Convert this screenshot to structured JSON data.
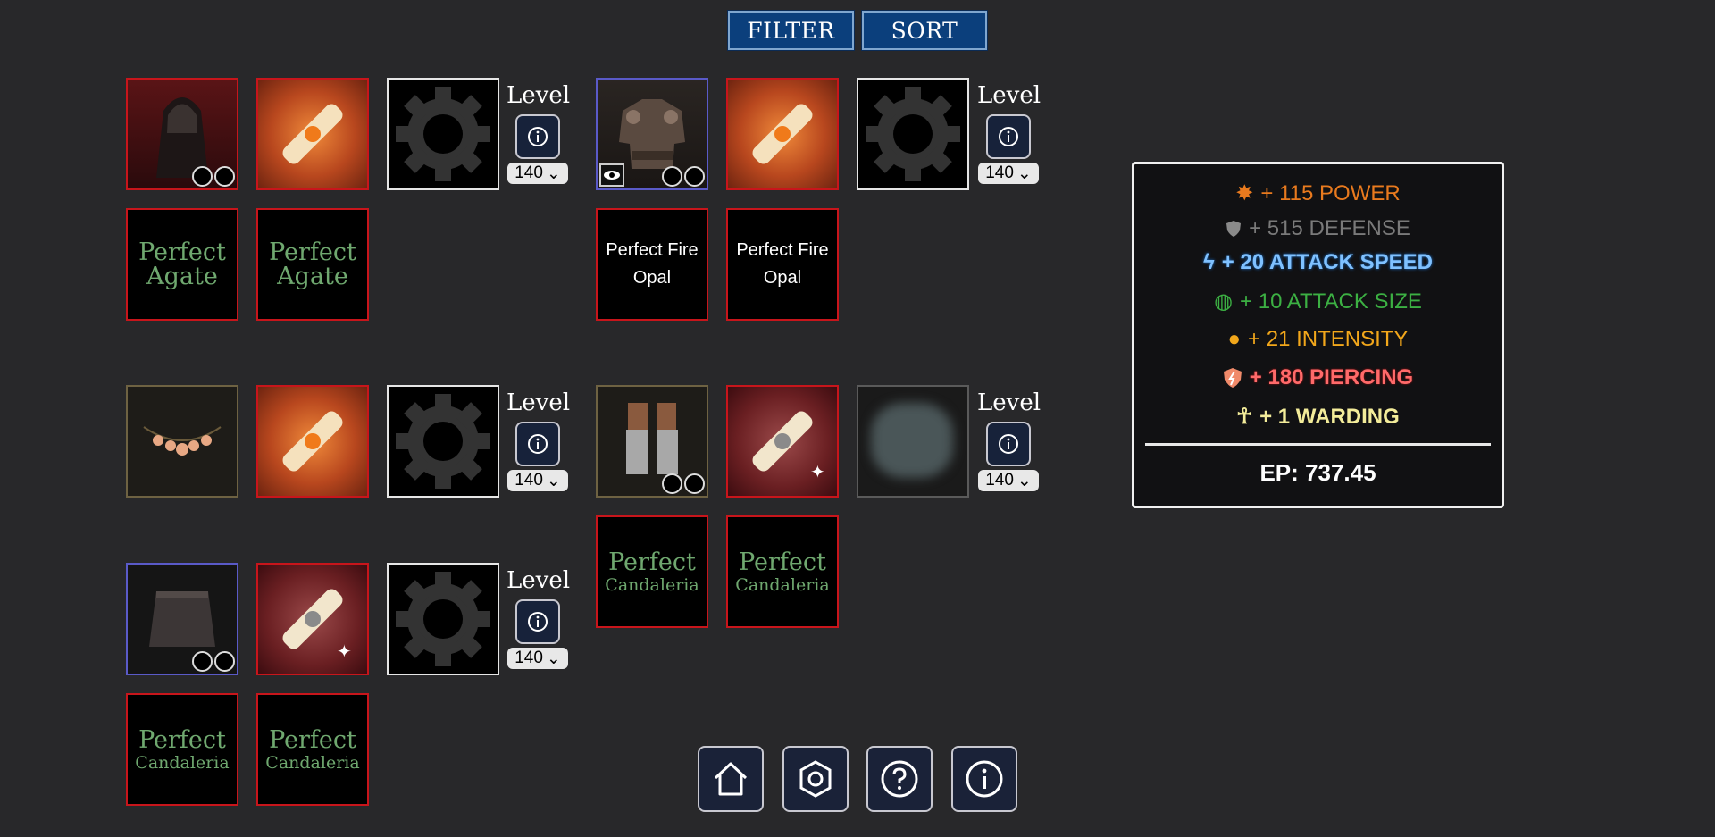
{
  "toolbar": {
    "filter_label": "FILTER",
    "sort_label": "SORT"
  },
  "level_label": "Level",
  "level_value": "140",
  "gems": {
    "agate": "Perfect",
    "agate_name": "Agate",
    "fire_opal": "Perfect Fire Opal",
    "candaleria_top": "Perfect",
    "candaleria_name": "Candaleria"
  },
  "stats": {
    "power": "+ 115 POWER",
    "defense": "+ 515 DEFENSE",
    "attack_speed": "+ 20 ATTACK SPEED",
    "attack_size": "+ 10 ATTACK SIZE",
    "intensity": "+ 21 INTENSITY",
    "piercing": "+ 180 PIERCING",
    "warding": "+ 1 WARDING",
    "ep": "EP: 737.45"
  },
  "colors": {
    "power": "#e97a1e",
    "defense": "#7a7a7a",
    "attack_speed": "#7fc1ff",
    "attack_size": "#3cb043",
    "intensity": "#f2a71b",
    "piercing": "#ff6a6a",
    "warding": "#f3ec9a"
  },
  "nav": [
    "home-icon",
    "settings-icon",
    "help-icon",
    "info-icon"
  ]
}
